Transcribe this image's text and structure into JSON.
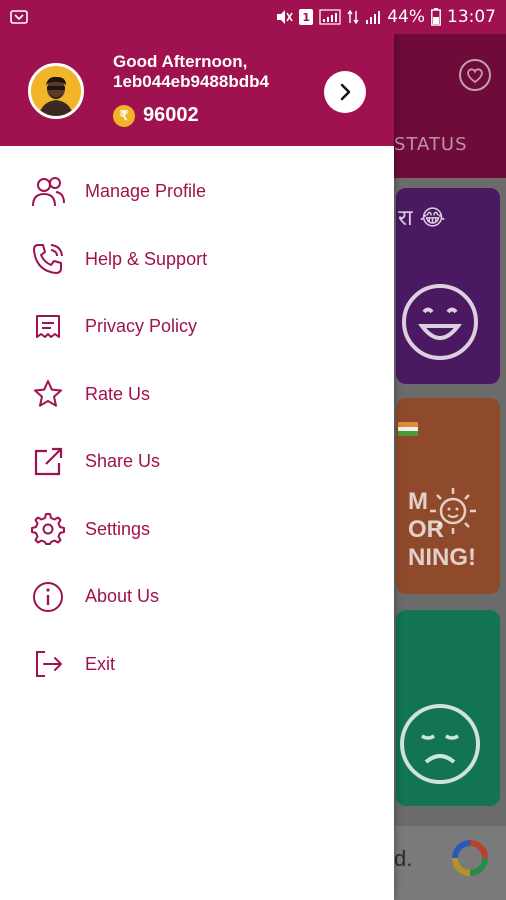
{
  "status_bar": {
    "battery": "44%",
    "time": "13:07",
    "sim_label": "1"
  },
  "drawer": {
    "greeting": "Good Afternoon,",
    "username": "1eb044eb9488bdb4",
    "coins": "96002",
    "coin_symbol": "₹",
    "menu": [
      {
        "label": "Manage Profile",
        "icon": "users-icon"
      },
      {
        "label": "Help & Support",
        "icon": "phone-support-icon"
      },
      {
        "label": "Privacy Policy",
        "icon": "receipt-icon"
      },
      {
        "label": "Rate Us",
        "icon": "star-icon"
      },
      {
        "label": "Share Us",
        "icon": "share-external-icon"
      },
      {
        "label": "Settings",
        "icon": "gear-icon"
      },
      {
        "label": "About Us",
        "icon": "info-icon"
      },
      {
        "label": "Exit",
        "icon": "exit-icon"
      }
    ]
  },
  "background": {
    "tab_label": "STATUS",
    "card1_text": "रा 😂",
    "card2_lines": [
      "M",
      "OR",
      "NING!"
    ],
    "ad_text": "d."
  },
  "colors": {
    "accent": "#a0124f",
    "coin": "#f2b52a"
  }
}
